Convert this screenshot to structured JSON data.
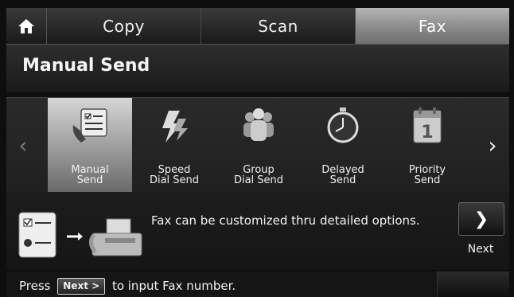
{
  "tabs": [
    {
      "label": "Copy"
    },
    {
      "label": "Scan"
    },
    {
      "label": "Fax",
      "active": true
    }
  ],
  "page": {
    "title": "Manual Send"
  },
  "options": [
    {
      "line1": "Manual",
      "line2": "Send",
      "icon": "manual-send-icon",
      "selected": true
    },
    {
      "line1": "Speed",
      "line2": "Dial Send",
      "icon": "speed-dial-icon"
    },
    {
      "line1": "Group",
      "line2": "Dial Send",
      "icon": "group-dial-icon"
    },
    {
      "line1": "Delayed",
      "line2": "Send",
      "icon": "delayed-send-icon"
    },
    {
      "line1": "Priority",
      "line2": "Send",
      "icon": "priority-send-icon"
    }
  ],
  "info": {
    "text": "Fax can be customized thru detailed options.",
    "next_label": "Next"
  },
  "status": {
    "before": "Press",
    "key": "Next >",
    "after": "to input Fax number."
  },
  "colors": {
    "selected_bg": "#b0b0b0",
    "bar_bg": "#1a1a1a"
  }
}
